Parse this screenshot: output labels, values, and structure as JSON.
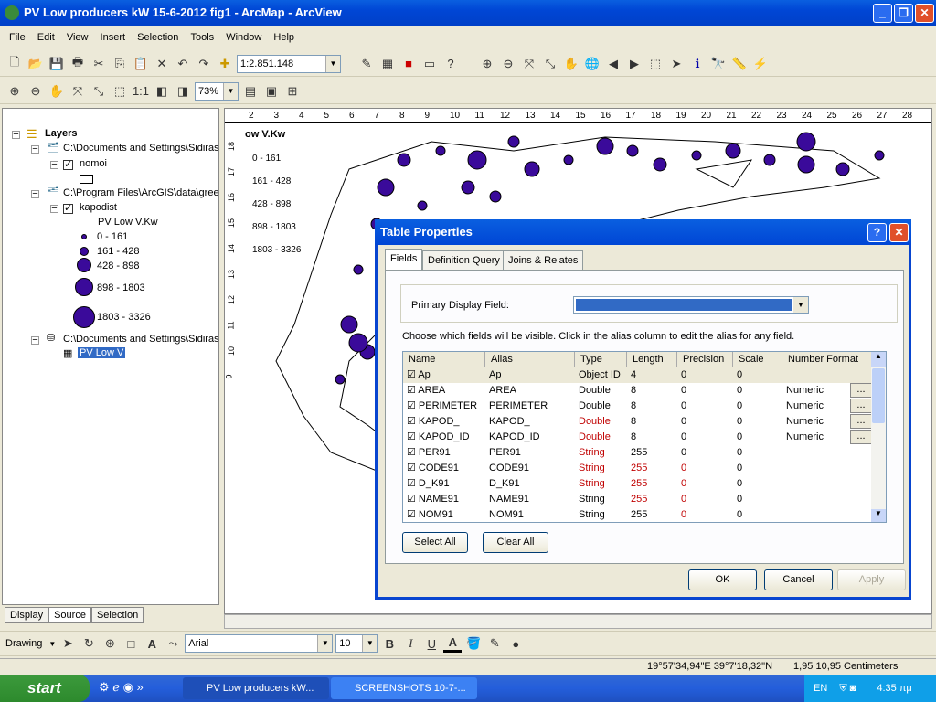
{
  "window": {
    "title": "PV Low producers kW 15-6-2012 fig1 - ArcMap - ArcView",
    "min": "_",
    "max": "❐",
    "close": "✕"
  },
  "menu": [
    "File",
    "Edit",
    "View",
    "Insert",
    "Selection",
    "Tools",
    "Window",
    "Help"
  ],
  "toolbar": {
    "scale": "1:2.851.148",
    "zoom": "73%"
  },
  "toc": {
    "root": "Layers",
    "items": [
      {
        "label": "C:\\Documents and Settings\\Sidiras"
      },
      {
        "label": "nomoi"
      },
      {
        "label": "C:\\Program Files\\ArcGIS\\data\\gree"
      },
      {
        "label": "kapodist"
      },
      {
        "label": "PV Low V.Kw"
      },
      {
        "label": "0 - 161"
      },
      {
        "label": "161 - 428"
      },
      {
        "label": "428 - 898"
      },
      {
        "label": "898 - 1803"
      },
      {
        "label": "1803 - 3326"
      },
      {
        "label": "C:\\Documents and Settings\\Sidiras"
      },
      {
        "label": "PV Low V"
      }
    ],
    "tabs": [
      "Display",
      "Source",
      "Selection"
    ]
  },
  "map": {
    "legend_title": "ow V.Kw",
    "legend": [
      "0 - 161",
      "161 - 428",
      "428 - 898",
      "898 - 1803",
      "1803 - 3326"
    ],
    "ruler": [
      "2",
      "3",
      "4",
      "5",
      "6",
      "7",
      "8",
      "9",
      "10",
      "11",
      "12",
      "13",
      "14",
      "15",
      "16",
      "17",
      "18",
      "19",
      "20",
      "21",
      "22",
      "23",
      "24",
      "25",
      "26",
      "27",
      "28"
    ],
    "vruler": [
      "18",
      "17",
      "16",
      "15",
      "14",
      "13",
      "12",
      "11",
      "10",
      "9"
    ],
    "symbol_color": "#3a0a9a"
  },
  "dialog": {
    "title": "Table Properties",
    "help": "?",
    "close": "✕",
    "tabs": [
      "Fields",
      "Definition Query",
      "Joins & Relates"
    ],
    "primary_label": "Primary Display Field:",
    "instructions": "Choose which fields will be visible. Click in the alias column to edit the alias for any field.",
    "columns": [
      "Name",
      "Alias",
      "Type",
      "Length",
      "Precision",
      "Scale",
      "Number Format"
    ],
    "rows": [
      [
        "Ap",
        "Ap",
        "Object ID",
        "4",
        "0",
        "0",
        ""
      ],
      [
        "AREA",
        "AREA",
        "Double",
        "8",
        "0",
        "0",
        "Numeric"
      ],
      [
        "PERIMETER",
        "PERIMETER",
        "Double",
        "8",
        "0",
        "0",
        "Numeric"
      ],
      [
        "KAPOD_",
        "KAPOD_",
        "Double",
        "8",
        "0",
        "0",
        "Numeric"
      ],
      [
        "KAPOD_ID",
        "KAPOD_ID",
        "Double",
        "8",
        "0",
        "0",
        "Numeric"
      ],
      [
        "PER91",
        "PER91",
        "String",
        "255",
        "0",
        "0",
        ""
      ],
      [
        "CODE91",
        "CODE91",
        "String",
        "255",
        "0",
        "0",
        ""
      ],
      [
        "D_K91",
        "D_K91",
        "String",
        "255",
        "0",
        "0",
        ""
      ],
      [
        "NAME91",
        "NAME91",
        "String",
        "255",
        "0",
        "0",
        ""
      ],
      [
        "NOM91",
        "NOM91",
        "String",
        "255",
        "0",
        "0",
        ""
      ]
    ],
    "ellipsis": "...",
    "select_all": "Select All",
    "clear_all": "Clear All",
    "ok": "OK",
    "cancel": "Cancel",
    "apply": "Apply"
  },
  "drawing": {
    "label": "Drawing",
    "font": "Arial",
    "size": "10",
    "bold": "B",
    "italic": "I",
    "underline": "U",
    "fontcolor": "A"
  },
  "status": {
    "coords": "19°57'34,94\"E  39°7'18,32\"N",
    "page": "1,95  10,95 Centimeters"
  },
  "taskbar": {
    "start": "start",
    "tasks": [
      "PV Low producers kW...",
      "SCREENSHOTS 10-7-..."
    ],
    "lang": "EN",
    "time": "4:35 πμ"
  }
}
